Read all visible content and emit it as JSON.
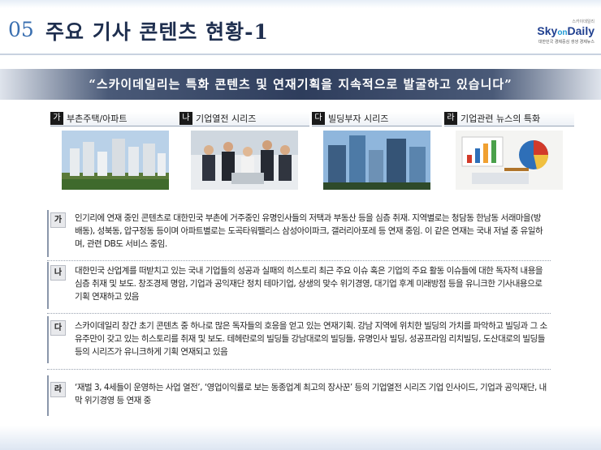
{
  "header": {
    "number": "05",
    "title": "주요 기사 콘텐츠 현황-1"
  },
  "logo": {
    "tagline_top": "스카이데일리",
    "brand_a": "Sky",
    "brand_on": "on",
    "brand_b": "Daily",
    "tagline_bottom": "대한민국 경제중심 생생 경제뉴스"
  },
  "banner": {
    "text": "“스카이데일리는  특화 콘텐츠 및 연재기획을 지속적으로 발굴하고 있습니다”"
  },
  "categories": [
    {
      "badge": "가",
      "label": "부촌주택/아파트",
      "photo": "apartment-complex"
    },
    {
      "badge": "나",
      "label": "기업열전 시리즈",
      "photo": "business-people"
    },
    {
      "badge": "다",
      "label": "빌딩부자 시리즈",
      "photo": "office-buildings"
    },
    {
      "badge": "라",
      "label": "기업관련 뉴스의 특화",
      "photo": "business-charts"
    }
  ],
  "details": [
    {
      "badge": "가",
      "text": "인기리에 연재 중인 콘텐츠로 대한민국 부촌에 거주중인 유명인사들의 저택과 부동산 등을 심층 취재. 지역별로는 청담동 한남동 서래마을(방배동), 성북동, 압구정동 등이며 아파트별로는 도곡타워팰리스 삼성아이파크, 갤러리아포레 등 연재 중임.  이 같은 연재는 국내 저널 중 유일하며, 관련 DB도 서비스 중임."
    },
    {
      "badge": "나",
      "text": "대한민국 산업계를 떠받치고 있는 국내 기업들의 성공과 실패의 히스토리 최근 주요 이슈 혹은 기업의 주요 활동 이슈들에 대한 독자적 내용을 심층 취재 및 보도. 창조경제 명암, 기업과 공익재단 정치 테마기업, 상생의 맞수 위기경영, 대기업 후계 미래방점  등을 유니크한 기사내용으로 기획 연재하고 있음"
    },
    {
      "badge": "다",
      "text": "스카이데일리 창간 초기 콘텐츠 중 하나로 많은 독자들의 호응을 얻고 있는 연재기획. 강남 지역에 위치한 빌딩의 가치를 파악하고 빌딩과 그 소유주만이 갖고 있는 히스토리를 취재 및 보도. 테헤란로의 빌딩들 강남대로의 빌딩들, 유명인사 빌딩, 성공프라임 리치빌딩, 도산대로의 빌딩들 등의 시리즈가 유니크하게 기획 연재되고 있음"
    },
    {
      "badge": "라",
      "text": "‘재벌 3, 4세들이 운영하는 사업 열전’,  ‘영업이익률로 보는 동종업계 최고의 장사꾼’ 등의 기업열전 시리즈 기업 인사이드, 기업과 공익재단, 내막 위기경영 등 연재 중"
    }
  ]
}
